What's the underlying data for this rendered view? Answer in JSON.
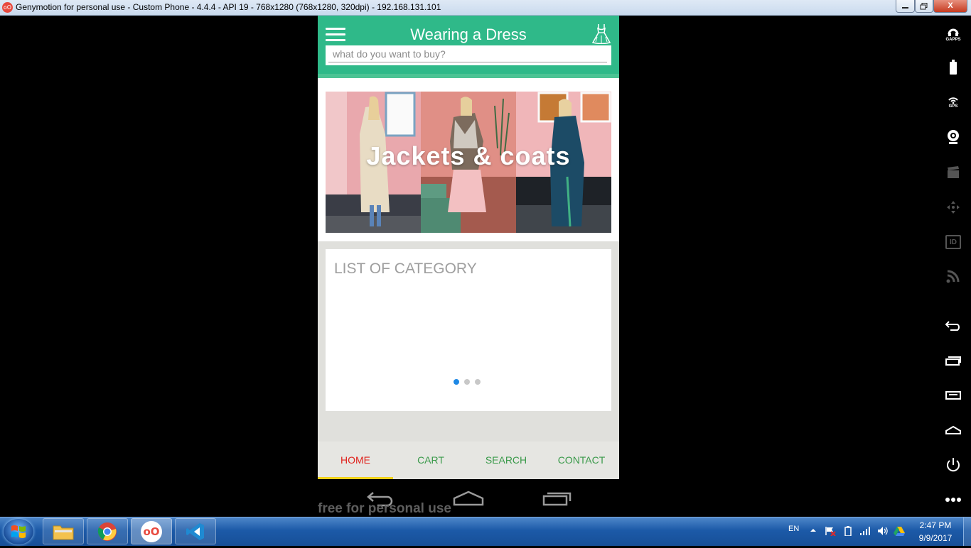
{
  "window": {
    "icon": "genymotion-icon",
    "icon_text": "oO",
    "title": "Genymotion for personal use - Custom Phone - 4.4.4 - API 19 - 768x1280 (768x1280, 320dpi) - 192.168.131.101",
    "close_glyph": "X"
  },
  "toolbar": {
    "gapps_caption": "GAPPS",
    "gps_caption": "GPS",
    "id_caption": "ID"
  },
  "app": {
    "title": "Wearing a Dress",
    "search_placeholder": "what do you want to buy?",
    "banner_text": "Jackets & coats",
    "category_title": "LIST OF CATEGORY",
    "carousel": {
      "pages": 3,
      "active_page": 1
    },
    "nav": {
      "home": "HOME",
      "cart": "CART",
      "search": "SEARCH",
      "contact": "CONTACT",
      "active": "HOME"
    },
    "colors": {
      "primary": "#2fb989",
      "active_tab": "#e0221c",
      "tab": "#3a9a4a",
      "indicator": "#f2d21b",
      "dot_active": "#1e88e5"
    }
  },
  "watermark": "free for personal use",
  "taskbar": {
    "language": "EN",
    "time": "2:47 PM",
    "date": "9/9/2017",
    "genymotion_task_text": "oO"
  }
}
